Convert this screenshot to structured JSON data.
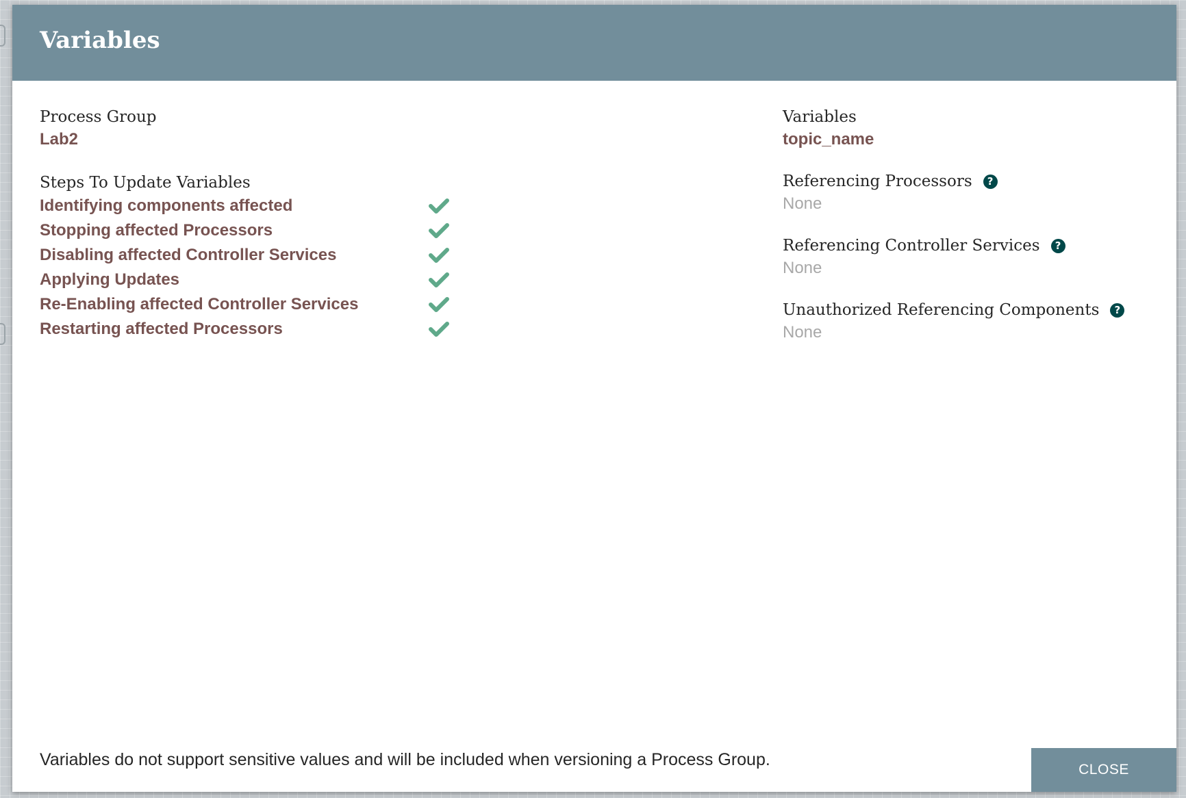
{
  "dialog": {
    "title": "Variables"
  },
  "process_group": {
    "label": "Process Group",
    "value": "Lab2"
  },
  "steps": {
    "label": "Steps To Update Variables",
    "items": [
      {
        "label": "Identifying components affected",
        "status": "complete",
        "icon": "check-icon"
      },
      {
        "label": "Stopping affected Processors",
        "status": "complete",
        "icon": "check-icon"
      },
      {
        "label": "Disabling affected Controller Services",
        "status": "complete",
        "icon": "check-icon"
      },
      {
        "label": "Applying Updates",
        "status": "complete",
        "icon": "check-icon"
      },
      {
        "label": "Re-Enabling affected Controller Services",
        "status": "complete",
        "icon": "check-icon"
      },
      {
        "label": "Restarting affected Processors",
        "status": "complete",
        "icon": "check-icon"
      }
    ]
  },
  "variables": {
    "label": "Variables",
    "value": "topic_name"
  },
  "referencing_processors": {
    "label": "Referencing Processors",
    "value": "None",
    "help_icon": "question-circle-icon"
  },
  "referencing_controller_services": {
    "label": "Referencing Controller Services",
    "value": "None",
    "help_icon": "question-circle-icon"
  },
  "unauthorized_referencing_components": {
    "label": "Unauthorized Referencing Components",
    "value": "None",
    "help_icon": "question-circle-icon"
  },
  "footer": {
    "note": "Variables do not support sensitive values and will be included when versioning a Process Group.",
    "close_label": "CLOSE"
  },
  "colors": {
    "header": "#728e9b",
    "link_text": "#775351",
    "check": "#5fa98a",
    "help_icon": "#004849",
    "muted": "#a8a8a8"
  }
}
